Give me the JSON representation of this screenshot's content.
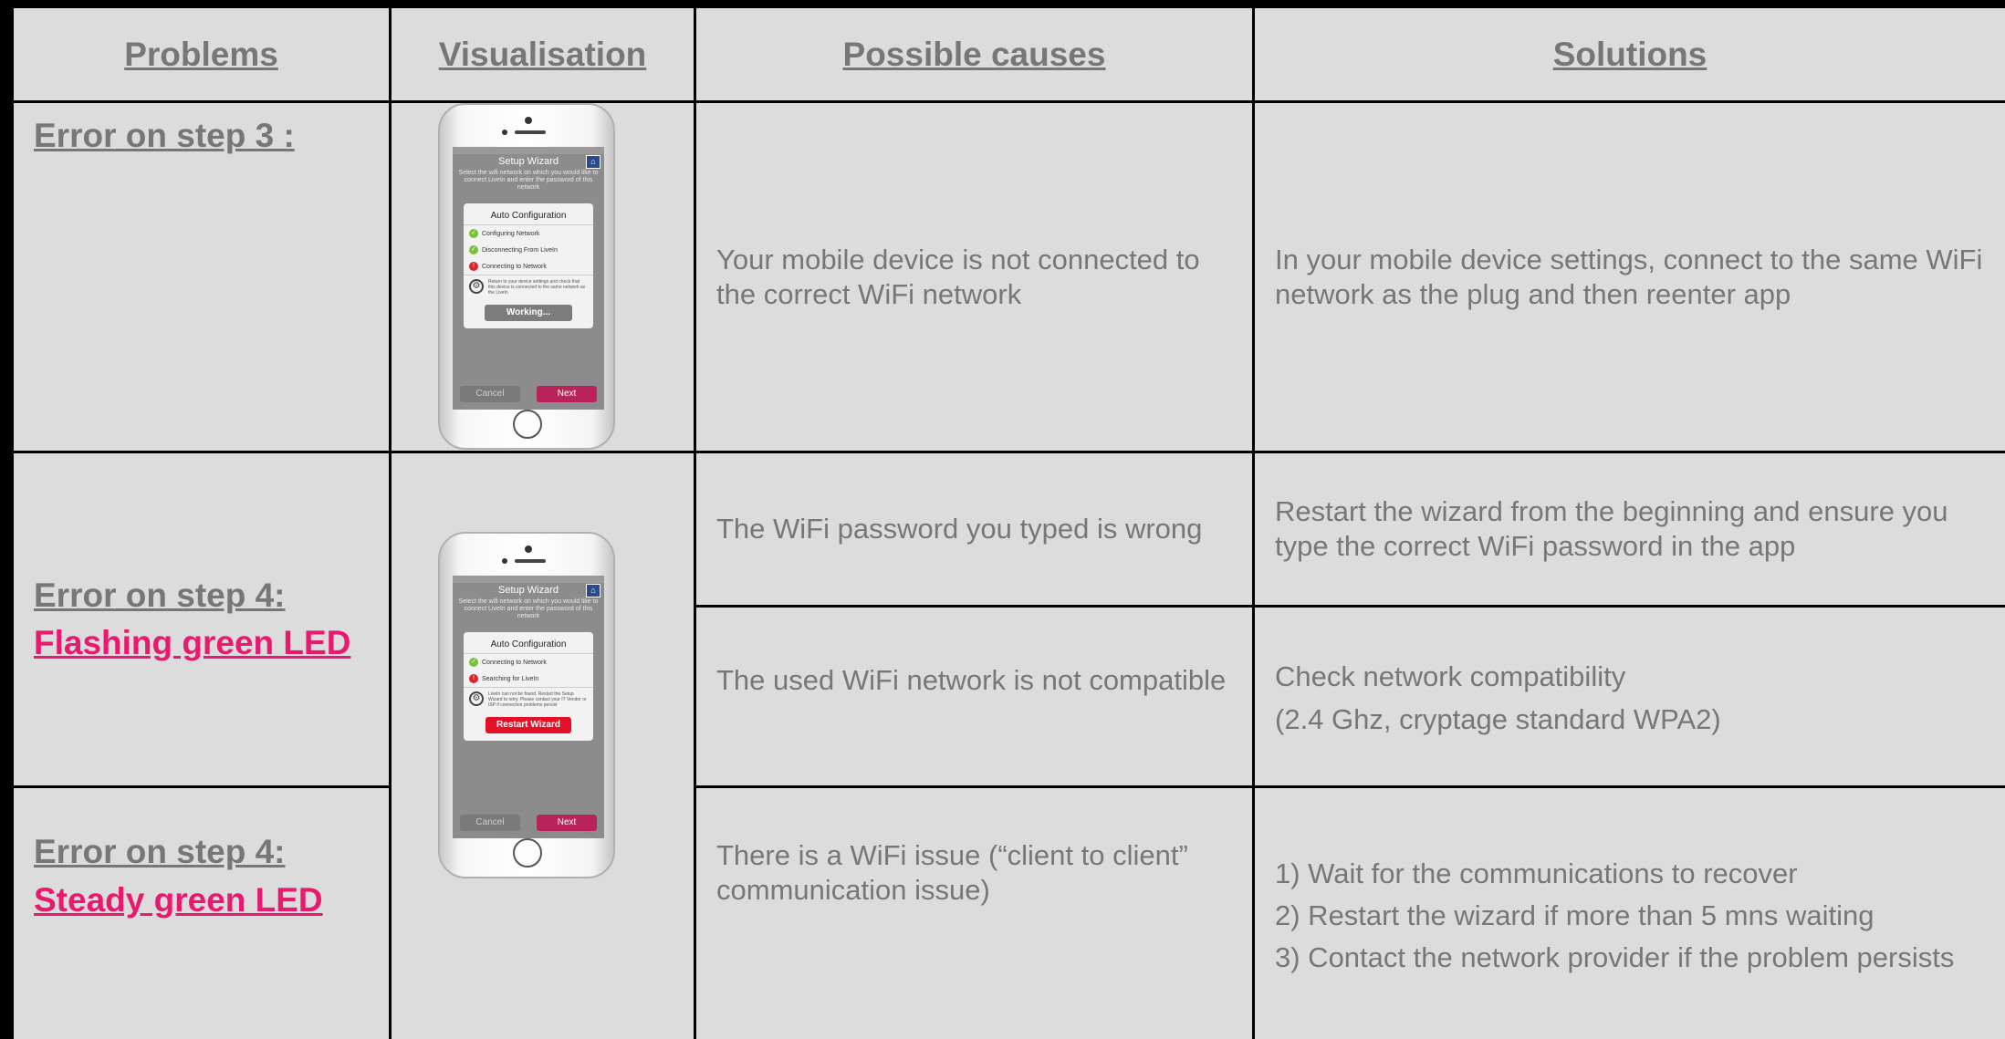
{
  "headers": {
    "problems": "Problems",
    "visualisation": "Visualisation",
    "causes": "Possible causes",
    "solutions": "Solutions"
  },
  "rows": {
    "step3": {
      "problem": "Error on step 3 :",
      "cause": "Your mobile device is not connected to the correct WiFi network",
      "solution": "In your mobile device settings, connect to the same WiFi network as the  plug  and then reenter app"
    },
    "step4_flashing": {
      "problem_line1": "Error on step 4:",
      "problem_line2": "Flashing green LED",
      "cause_a": "The WiFi password you typed is wrong",
      "solution_a": "Restart the wizard from the beginning and ensure  you type the correct WiFi password in the app",
      "cause_b": "The used WiFi network is not compatible",
      "solution_b_line1": "Check network compatibility",
      "solution_b_line2": "(2.4 Ghz, cryptage standard WPA2)"
    },
    "step4_steady": {
      "problem_line1": "Error on step 4:",
      "problem_line2": "Steady green LED",
      "cause": "There is a WiFi issue (“client to client” communication issue)",
      "solution_line1": "1)  Wait for the communications to recover",
      "solution_line2": "2) Restart the wizard if more than 5 mns waiting",
      "solution_line3": "3) Contact the network provider if the problem persists"
    }
  },
  "phone1": {
    "title": "Setup Wizard",
    "subtitle": "Select the wifi network on which you would like to connect LiveIn and enter the password of this network",
    "dialog_title": "Auto Configuration",
    "row1": "Configuring Network",
    "row2": "Disconnecting From LiveIn",
    "row3": "Connecting to Network",
    "note": "Return to your device settings and check that this device is connected to the same network as the LiveIn",
    "action": "Working...",
    "cancel": "Cancel",
    "next": "Next"
  },
  "phone2": {
    "title": "Setup Wizard",
    "subtitle": "Select the wifi network on which you would like to connect LiveIn and enter the password of this network",
    "dialog_title": "Auto Configuration",
    "row1": "Connecting to Network",
    "row2": "Searching for LiveIn",
    "note": "LiveIn can not be found. Restart the Setup Wizard to retry. Please contact your IT Vendor or ISP if connection problems persist",
    "action": "Restart Wizard",
    "cancel": "Cancel",
    "next": "Next"
  },
  "colors": {
    "cell_bg": "#dcdcdc",
    "text": "#777777",
    "accent": "#e8196e"
  }
}
